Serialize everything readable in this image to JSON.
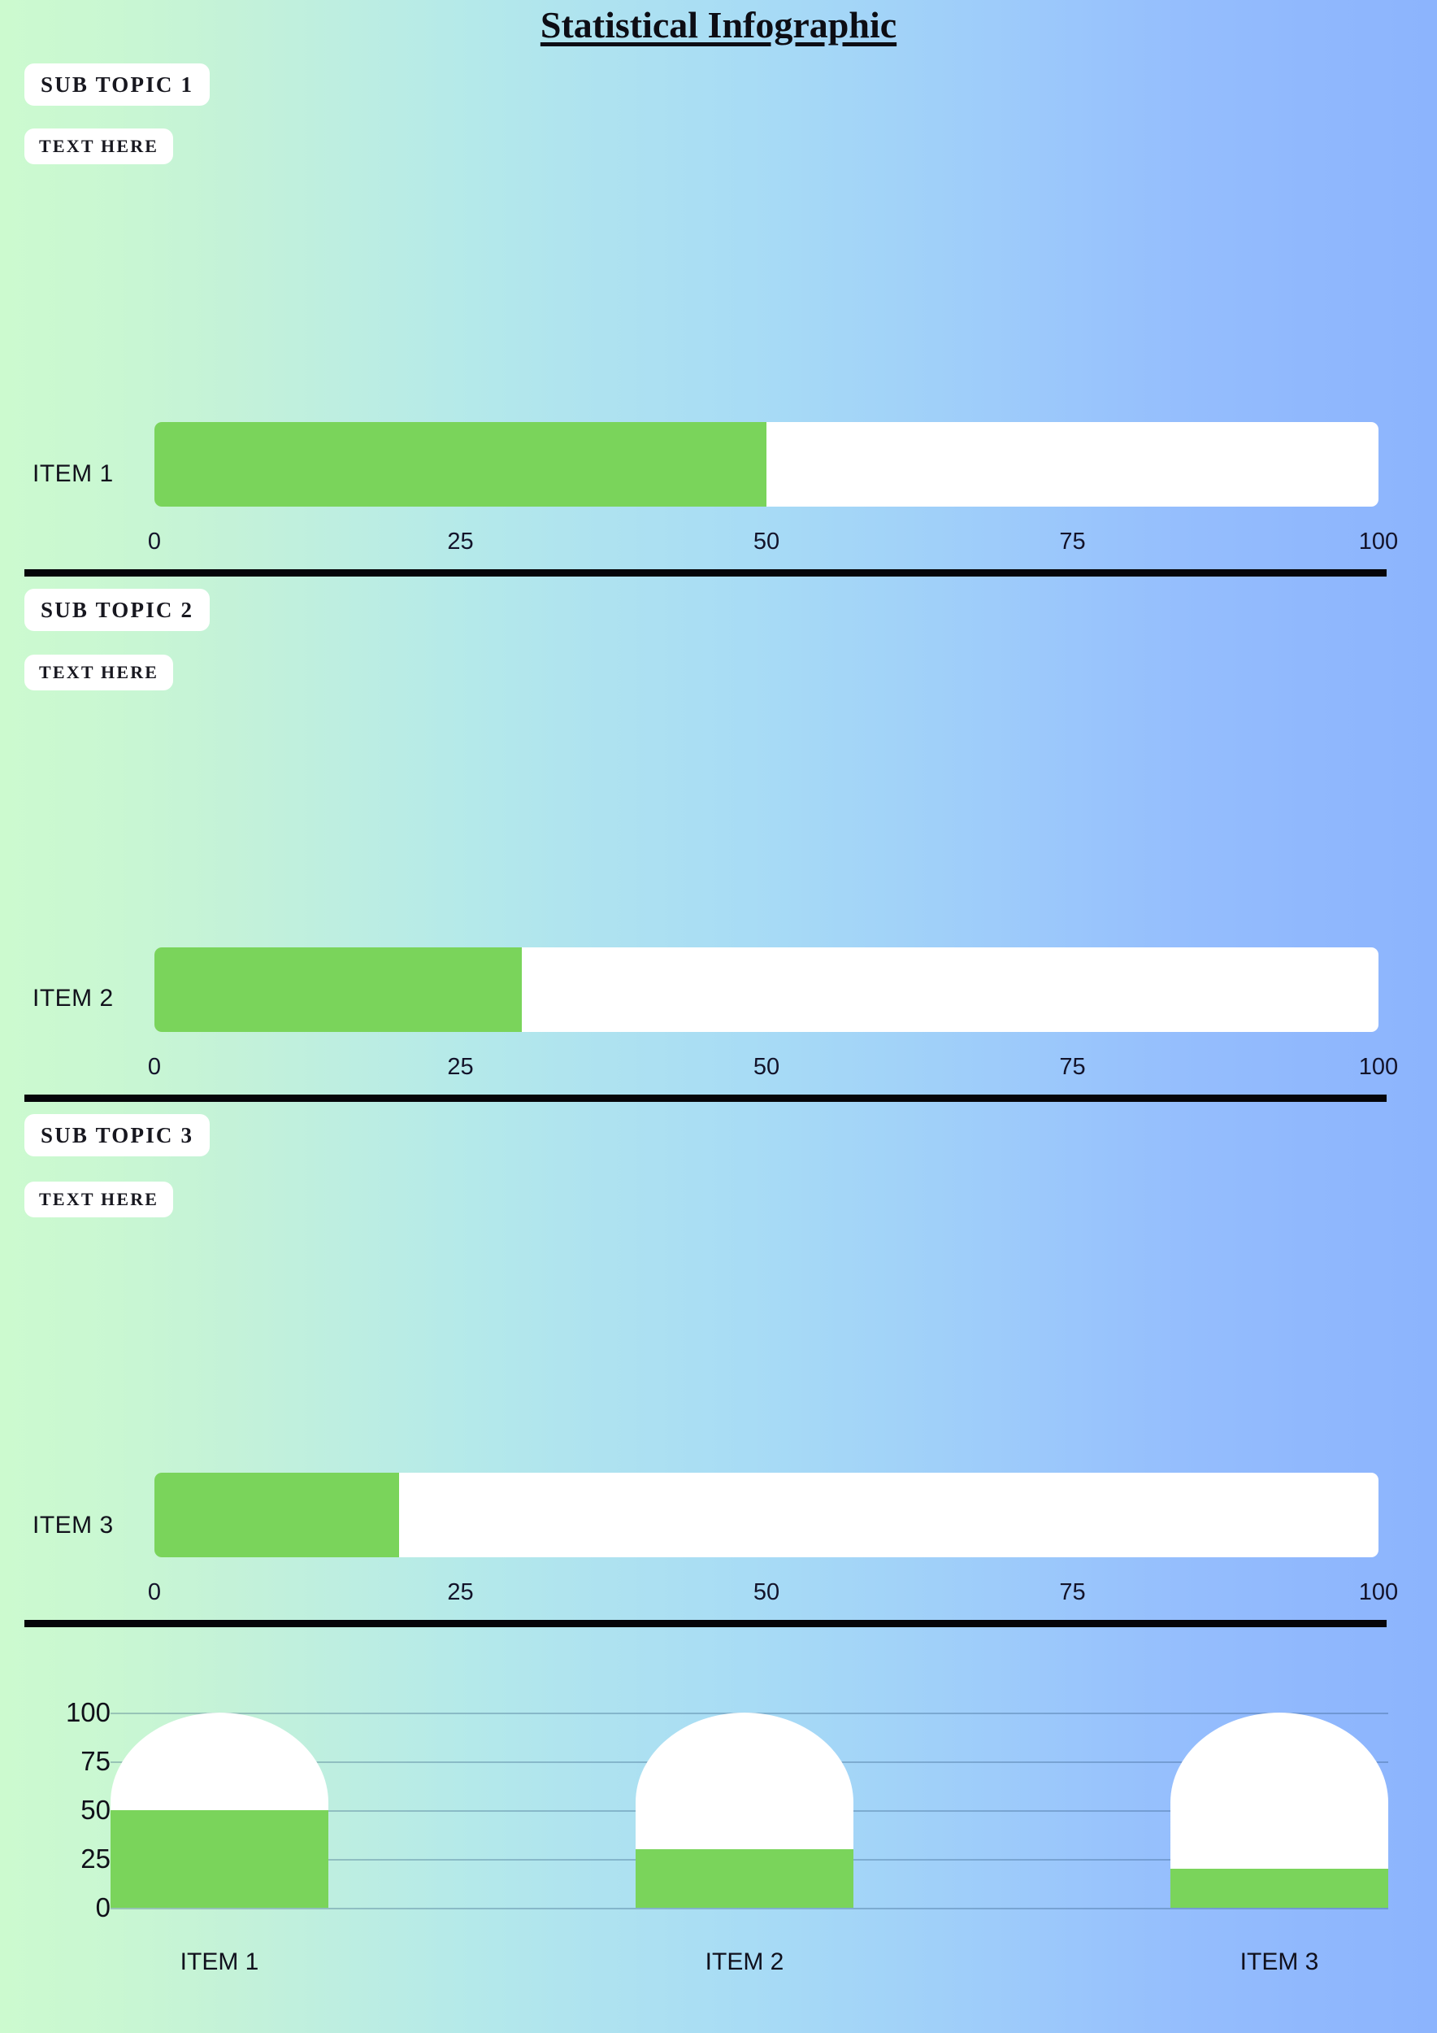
{
  "header": {
    "title": "Statistical Infographic"
  },
  "sections": [
    {
      "topic_label": "SUB TOPIC 1",
      "text_label": "TEXT HERE",
      "item_label": "ITEM 1",
      "value": 50
    },
    {
      "topic_label": "SUB TOPIC 2",
      "text_label": "TEXT HERE",
      "item_label": "ITEM 2",
      "value": 30
    },
    {
      "topic_label": "SUB TOPIC 3",
      "text_label": "TEXT HERE",
      "item_label": "ITEM 3",
      "value": 20
    }
  ],
  "axis_ticks": [
    "0",
    "25",
    "50",
    "75",
    "100"
  ],
  "colors": {
    "bar_fill": "#7ad45b",
    "bar_track": "#ffffff",
    "rule": "#050509",
    "bg_left": "#ccfacf",
    "bg_right": "#8cb4fd"
  },
  "chart_data": [
    {
      "type": "bar",
      "orientation": "horizontal",
      "title": "",
      "categories": [
        "ITEM 1"
      ],
      "values": [
        50
      ],
      "xlabel": "",
      "ylabel": "",
      "xlim": [
        0,
        100
      ],
      "tick_labels": [
        "0",
        "25",
        "50",
        "75",
        "100"
      ],
      "grid": false,
      "legend": "none",
      "series": [
        {
          "name": "ITEM 1",
          "values": [
            50
          ]
        }
      ]
    },
    {
      "type": "bar",
      "orientation": "horizontal",
      "title": "",
      "categories": [
        "ITEM 2"
      ],
      "values": [
        30
      ],
      "xlabel": "",
      "ylabel": "",
      "xlim": [
        0,
        100
      ],
      "tick_labels": [
        "0",
        "25",
        "50",
        "75",
        "100"
      ],
      "grid": false,
      "legend": "none",
      "series": [
        {
          "name": "ITEM 2",
          "values": [
            30
          ]
        }
      ]
    },
    {
      "type": "bar",
      "orientation": "horizontal",
      "title": "",
      "categories": [
        "ITEM 3"
      ],
      "values": [
        20
      ],
      "xlabel": "",
      "ylabel": "",
      "xlim": [
        0,
        100
      ],
      "tick_labels": [
        "0",
        "25",
        "50",
        "75",
        "100"
      ],
      "grid": false,
      "legend": "none",
      "series": [
        {
          "name": "ITEM 3",
          "values": [
            20
          ]
        }
      ]
    },
    {
      "type": "bar",
      "orientation": "vertical",
      "title": "",
      "categories": [
        "ITEM 1",
        "ITEM 2",
        "ITEM 3"
      ],
      "values": [
        50,
        30,
        20
      ],
      "capacity": [
        100,
        100,
        100
      ],
      "xlabel": "",
      "ylabel": "",
      "ylim": [
        0,
        100
      ],
      "tick_labels": [
        "0",
        "25",
        "50",
        "75",
        "100"
      ],
      "grid": true,
      "legend": "none",
      "series": [
        {
          "name": "value",
          "values": [
            50,
            30,
            20
          ]
        }
      ]
    }
  ],
  "dome_chart": {
    "y_ticks": [
      "100",
      "75",
      "50",
      "25",
      "0"
    ],
    "bars": [
      {
        "label": "ITEM 1",
        "value": 50
      },
      {
        "label": "ITEM 2",
        "value": 30
      },
      {
        "label": "ITEM 3",
        "value": 20
      }
    ]
  }
}
